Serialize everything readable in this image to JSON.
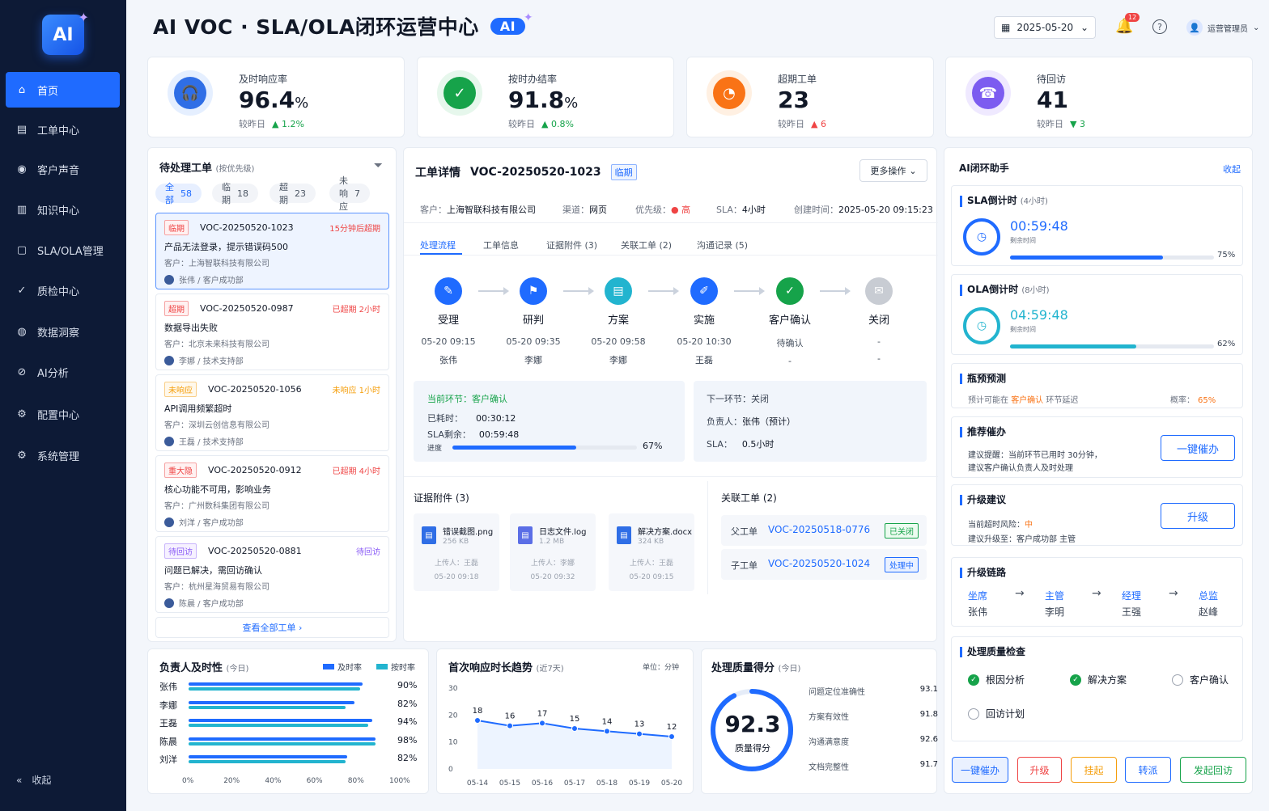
{
  "sidebar": {
    "logo": "AI",
    "items": [
      {
        "label": "首页",
        "icon": "home-icon"
      },
      {
        "label": "工单中心",
        "icon": "ticket-icon"
      },
      {
        "label": "客户声音",
        "icon": "voice-icon"
      },
      {
        "label": "知识中心",
        "icon": "book-icon"
      },
      {
        "label": "SLA/OLA管理",
        "icon": "sla-icon"
      },
      {
        "label": "质检中心",
        "icon": "check-icon"
      },
      {
        "label": "数据洞察",
        "icon": "insight-icon"
      },
      {
        "label": "AI分析",
        "icon": "ai-icon"
      },
      {
        "label": "配置中心",
        "icon": "config-icon"
      },
      {
        "label": "系统管理",
        "icon": "settings-icon"
      }
    ],
    "collapse": "收起"
  },
  "header": {
    "title": "AI VOC · SLA/OLA闭环运营中心",
    "badge": "AI",
    "date": "2025-05-20",
    "notif": "12",
    "user": "运营管理员"
  },
  "kpis": [
    {
      "label": "及时响应率",
      "value": "96.4",
      "unit": "%",
      "cmp": "较昨日",
      "delta": "▲ 1.2%",
      "color": "#2f6ee6",
      "icon": "headset-icon"
    },
    {
      "label": "按时办结率",
      "value": "91.8",
      "unit": "%",
      "cmp": "较昨日",
      "delta": "▲ 0.8%",
      "color": "#16a34a",
      "icon": "check-circle-icon"
    },
    {
      "label": "超期工单",
      "value": "23",
      "unit": "",
      "cmp": "较昨日",
      "delta": "▲ 6",
      "color": "#f97316",
      "icon": "clock-icon"
    },
    {
      "label": "待回访",
      "value": "41",
      "unit": "",
      "cmp": "较昨日",
      "delta": "▼ 3",
      "color": "#7c5cf0",
      "icon": "phone-icon"
    }
  ],
  "pending": {
    "title": "待处理工单",
    "sub": "(按优先级)",
    "filters": [
      {
        "label": "全部",
        "count": "58"
      },
      {
        "label": "临期",
        "count": "18"
      },
      {
        "label": "超期",
        "count": "23"
      },
      {
        "label": "未响应",
        "count": "7"
      }
    ],
    "tickets": [
      {
        "tag": "临期",
        "tagc": "r",
        "id": "VOC-20250520-1023",
        "status": "15分钟后超期",
        "sc": "#ef4444",
        "title": "产品无法登录，提示错误码500",
        "cust": "客户：上海智联科技有限公司",
        "owner": "张伟 / 客户成功部"
      },
      {
        "tag": "超期",
        "tagc": "r",
        "id": "VOC-20250520-0987",
        "status": "已超期 2小时",
        "sc": "#ef4444",
        "title": "数据导出失败",
        "cust": "客户：北京未来科技有限公司",
        "owner": "李娜 / 技术支持部"
      },
      {
        "tag": "未响应",
        "tagc": "o",
        "id": "VOC-20250520-1056",
        "status": "未响应 1小时",
        "sc": "#f59e0b",
        "title": "API调用频繁超时",
        "cust": "客户：深圳云创信息有限公司",
        "owner": "王磊 / 技术支持部"
      },
      {
        "tag": "重大隐",
        "tagc": "r",
        "id": "VOC-20250520-0912",
        "status": "已超期 4小时",
        "sc": "#ef4444",
        "title": "核心功能不可用，影响业务",
        "cust": "客户：广州数科集团有限公司",
        "owner": "刘洋 / 客户成功部"
      },
      {
        "tag": "待回访",
        "tagc": "p",
        "id": "VOC-20250520-0881",
        "status": "待回访",
        "sc": "#8b5cf6",
        "title": "问题已解决，需回访确认",
        "cust": "客户：杭州星海贸易有限公司",
        "owner": "陈晨 / 客户成功部"
      }
    ],
    "viewall": "查看全部工单 ›"
  },
  "detail": {
    "title": "工单详情",
    "id": "VOC-20250520-1023",
    "tag": "临期",
    "more": "更多操作",
    "meta": {
      "cust_l": "客户：",
      "cust": "上海智联科技有限公司",
      "ch_l": "渠道：",
      "ch": "网页",
      "pr_l": "优先级：",
      "pr": "● 高",
      "sla_l": "SLA：",
      "sla": "4小时",
      "ct_l": "创建时间：",
      "ct": "2025-05-20 09:15:23"
    },
    "tabs": [
      "处理流程",
      "工单信息",
      "证据附件 (3)",
      "关联工单 (2)",
      "沟通记录 (5)"
    ],
    "steps": [
      {
        "name": "受理",
        "time": "05-20 09:15",
        "person": "张伟",
        "color": "#1f6bff",
        "icon": "✎"
      },
      {
        "name": "研判",
        "time": "05-20 09:35",
        "person": "李娜",
        "color": "#1f6bff",
        "icon": "⚑"
      },
      {
        "name": "方案",
        "time": "05-20 09:58",
        "person": "李娜",
        "color": "#22b4cf",
        "icon": "▤"
      },
      {
        "name": "实施",
        "time": "05-20 10:30",
        "person": "王磊",
        "color": "#1f6bff",
        "icon": "✐"
      },
      {
        "name": "客户确认",
        "time": "待确认",
        "person": "-",
        "color": "#16a34a",
        "icon": "✓"
      },
      {
        "name": "关闭",
        "time": "-",
        "person": "-",
        "color": "#c8ccd3",
        "icon": "✉"
      }
    ],
    "cur": {
      "label": "当前环节：",
      "stage": "客户确认",
      "used_l": "已耗时：",
      "used": "00:30:12",
      "left_l": "SLA剩余：",
      "left": "00:59:48",
      "prog_l": "进度",
      "prog": "67%",
      "prog_v": 67
    },
    "next": {
      "label": "下一环节：",
      "stage": "关闭",
      "owner_l": "负责人：",
      "owner": "张伟（预计）",
      "sla_l": "SLA：",
      "sla": "0.5小时"
    },
    "att_title": "证据附件",
    "att_count": "(3)",
    "files": [
      {
        "name": "错误截图.png",
        "size": "256 KB",
        "up": "上传人：王磊",
        "time": "05-20 09:18",
        "color": "#2f6ee6"
      },
      {
        "name": "日志文件.log",
        "size": "1.2 MB",
        "up": "上传人：李娜",
        "time": "05-20 09:32",
        "color": "#5b6ee6"
      },
      {
        "name": "解决方案.docx",
        "size": "324 KB",
        "up": "上传人：王磊",
        "time": "05-20 09:15",
        "color": "#2f6ee6"
      }
    ],
    "rel_title": "关联工单",
    "rel_count": "(2)",
    "rel": [
      {
        "type": "父工单",
        "id": "VOC-20250518-0776",
        "status": "已关闭",
        "sc": "#16a34a",
        "sb": "#ecfbf0"
      },
      {
        "type": "子工单",
        "id": "VOC-20250520-1024",
        "status": "处理中",
        "sc": "#1f6bff",
        "sb": "#eaf1ff"
      }
    ]
  },
  "ai": {
    "title": "AI闭环助手",
    "collapse": "收起",
    "sla": {
      "title": "SLA倒计时",
      "sub": "(4小时)",
      "time": "00:59:48",
      "label": "剩余时间",
      "pct": "75%",
      "pv": 75
    },
    "ola": {
      "title": "OLA倒计时",
      "sub": "(8小时)",
      "time": "04:59:48",
      "label": "剩余时间",
      "pct": "62%",
      "pv": 62
    },
    "bottleneck": {
      "title": "瓶预预测",
      "pre": "预计可能在",
      "hl": "客户确认",
      "post": "环节延迟",
      "prob_l": "概率：",
      "prob": "65%"
    },
    "urge": {
      "title": "推荐催办",
      "l1": "建议提醒：当前环节已用时 30分钟，",
      "l2": "建议客户确认负责人及时处理",
      "btn": "一键催办"
    },
    "esc": {
      "title": "升级建议",
      "risk_l": "当前超时风险：",
      "risk": "中",
      "sug": "建议升级至：客户成功部 主管",
      "btn": "升级"
    },
    "chain": {
      "title": "升级链路",
      "roles": [
        {
          "role": "坐席",
          "name": "张伟"
        },
        {
          "role": "主管",
          "name": "李明"
        },
        {
          "role": "经理",
          "name": "王强"
        },
        {
          "role": "总监",
          "name": "赵峰"
        }
      ]
    },
    "qc": {
      "title": "处理质量检查",
      "items": [
        {
          "label": "根因分析",
          "on": true
        },
        {
          "label": "解决方案",
          "on": true
        },
        {
          "label": "客户确认",
          "on": false
        },
        {
          "label": "回访计划",
          "on": false
        }
      ]
    },
    "actions": [
      {
        "label": "一键催办",
        "color": "#1f6bff",
        "bg": "#eaf1ff"
      },
      {
        "label": "升级",
        "color": "#ef4444",
        "bg": "#fff"
      },
      {
        "label": "挂起",
        "color": "#f59e0b",
        "bg": "#fff"
      },
      {
        "label": "转派",
        "color": "#1f6bff",
        "bg": "#fff"
      },
      {
        "label": "发起回访",
        "color": "#16a34a",
        "bg": "#fff"
      }
    ]
  },
  "owners": {
    "title": "负责人及时性",
    "sub": "(今日)",
    "leg1": "及时率",
    "leg2": "按时率",
    "ticks": [
      "0%",
      "20%",
      "40%",
      "60%",
      "80%",
      "100%"
    ]
  },
  "trend": {
    "title": "首次响应时长趋势",
    "sub": "(近7天)",
    "unit": "单位：分钟",
    "yticks": [
      "30",
      "20",
      "10",
      "0"
    ]
  },
  "quality": {
    "title": "处理质量得分",
    "sub": "(今日)",
    "score": "92.3",
    "score_l": "质量得分",
    "score_v": 92.3,
    "rows": [
      {
        "label": "问题定位准确性",
        "val": "93.1"
      },
      {
        "label": "方案有效性",
        "val": "91.8"
      },
      {
        "label": "沟通满意度",
        "val": "92.6"
      },
      {
        "label": "文档完整性",
        "val": "91.7"
      }
    ]
  },
  "chart_data": [
    {
      "type": "bar",
      "title": "负责人及时性",
      "categories": [
        "张伟",
        "李娜",
        "王磊",
        "陈晨",
        "刘洋"
      ],
      "series": [
        {
          "name": "及时率",
          "values": [
            91,
            87,
            96,
            98,
            83
          ]
        },
        {
          "name": "按时率",
          "values": [
            90,
            82,
            94,
            98,
            82
          ]
        }
      ],
      "value_labels": [
        "90%",
        "82%",
        "94%",
        "98%",
        "82%"
      ],
      "xlim": [
        0,
        100
      ],
      "legend": "top-right"
    },
    {
      "type": "line",
      "title": "首次响应时长趋势",
      "categories": [
        "05-14",
        "05-15",
        "05-16",
        "05-17",
        "05-18",
        "05-19",
        "05-20"
      ],
      "series": [
        {
          "values": [
            18,
            16,
            17,
            15,
            14,
            13,
            12
          ]
        }
      ],
      "ylim": [
        0,
        30
      ]
    }
  ]
}
